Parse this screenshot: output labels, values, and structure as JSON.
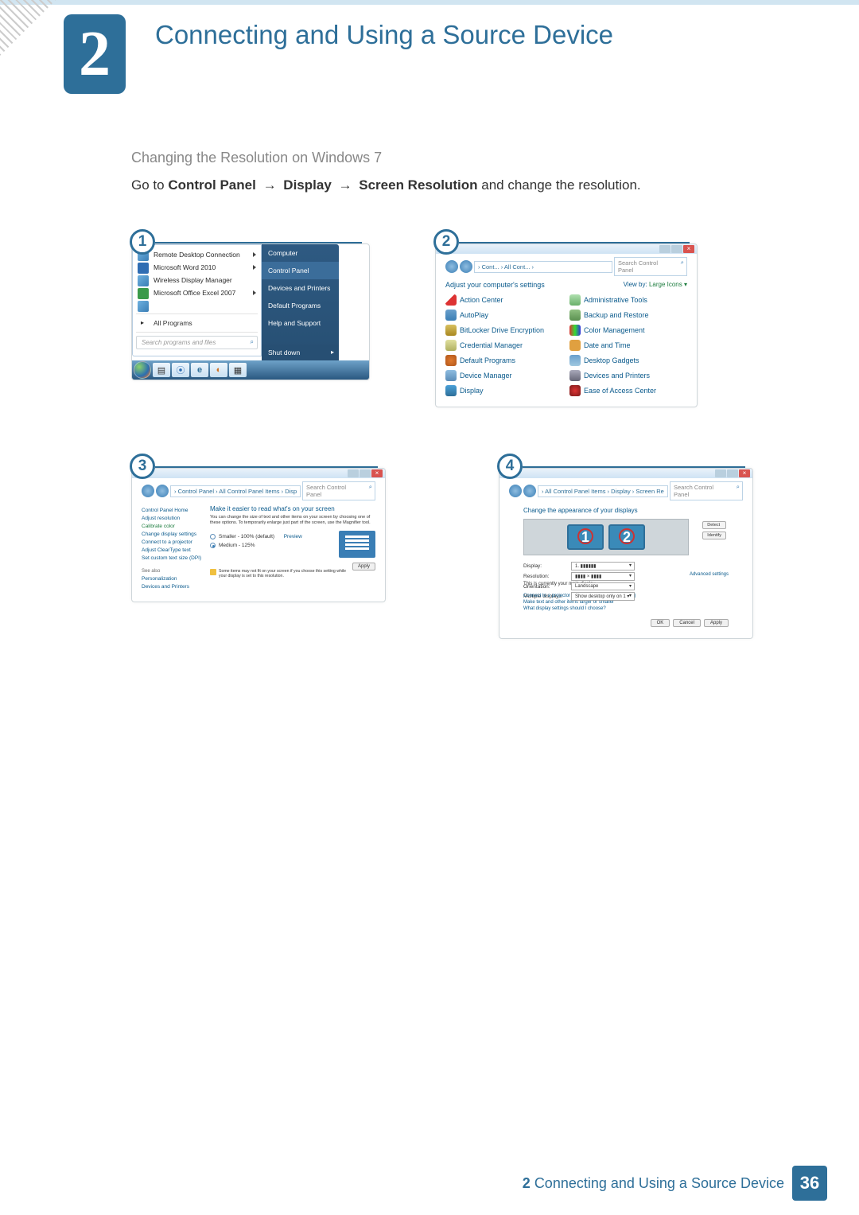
{
  "chapter": {
    "number": "2",
    "title": "Connecting and Using a Source Device"
  },
  "subheading": "Changing the Resolution on Windows 7",
  "instruction": {
    "prefix": "Go to ",
    "path1": "Control Panel",
    "path2": "Display",
    "path3": "Screen Resolution",
    "suffix": " and change the resolution."
  },
  "steps": [
    "1",
    "2",
    "3",
    "4"
  ],
  "shot1": {
    "menu_items": {
      "remote_desktop": "Remote Desktop Connection",
      "word": "Microsoft Word 2010",
      "wireless": "Wireless Display Manager",
      "excel": "Microsoft Office Excel 2007",
      "all_programs": "All Programs"
    },
    "search_placeholder": "Search programs and files",
    "right_items": {
      "computer": "Computer",
      "control_panel": "Control Panel",
      "devices_printers": "Devices and Printers",
      "default_programs": "Default Programs",
      "help": "Help and Support",
      "shutdown": "Shut down"
    }
  },
  "shot2": {
    "breadcrumb": "› Cont... › All Cont... ›",
    "search_placeholder": "Search Control Panel",
    "heading": "Adjust your computer's settings",
    "viewby_label": "View by:",
    "viewby_value": "Large Icons ▾",
    "items_left": [
      "Action Center",
      "AutoPlay",
      "BitLocker Drive Encryption",
      "Credential Manager",
      "Default Programs",
      "Device Manager",
      "Display"
    ],
    "items_right": [
      "Administrative Tools",
      "Backup and Restore",
      "Color Management",
      "Date and Time",
      "Desktop Gadgets",
      "Devices and Printers",
      "Ease of Access Center"
    ]
  },
  "shot3": {
    "breadcrumb": "› Control Panel › All Control Panel Items › Display",
    "search_placeholder": "Search Control Panel",
    "side": {
      "home": "Control Panel Home",
      "adjust_res": "Adjust resolution",
      "calibrate": "Calibrate color",
      "change_disp": "Change display settings",
      "projector": "Connect to a projector",
      "cleartype": "Adjust ClearType text",
      "dpi": "Set custom text size (DPI)",
      "see_also": "See also",
      "personalization": "Personalization",
      "dev_print": "Devices and Printers"
    },
    "main": {
      "title": "Make it easier to read what's on your screen",
      "desc": "You can change the size of text and other items on your screen by choosing one of these options. To temporarily enlarge just part of the screen, use the Magnifier tool.",
      "opt1": "Smaller - 100% (default)",
      "opt1_extra": "Preview",
      "opt2": "Medium - 125%",
      "warning": "Some items may not fit on your screen if you choose this setting while your display is set to this resolution.",
      "apply": "Apply"
    }
  },
  "shot4": {
    "breadcrumb": "› All Control Panel Items › Display › Screen Resolution",
    "search_placeholder": "Search Control Panel",
    "heading": "Change the appearance of your displays",
    "detect": "Detect",
    "identify": "Identify",
    "monitor_labels": [
      "1",
      "2"
    ],
    "form": {
      "display_label": "Display:",
      "display_value": "1. ▮▮▮▮▮▮",
      "resolution_label": "Resolution:",
      "resolution_value": "▮▮▮▮ × ▮▮▮▮",
      "orientation_label": "Orientation:",
      "orientation_value": "Landscape",
      "multiple_label": "Multiple displays:",
      "multiple_value": "Show desktop only on 1 ▾"
    },
    "main_note": "This is currently your main display.",
    "advanced": "Advanced settings",
    "links": {
      "projector": "Connect to a projector (or press the ⊞ key and tap P)",
      "textsize": "Make text and other items larger or smaller",
      "which": "What display settings should I choose?"
    },
    "buttons": {
      "ok": "OK",
      "cancel": "Cancel",
      "apply": "Apply"
    }
  },
  "footer": {
    "text_prefix": "2",
    "text": "Connecting and Using a Source Device",
    "page": "36"
  }
}
